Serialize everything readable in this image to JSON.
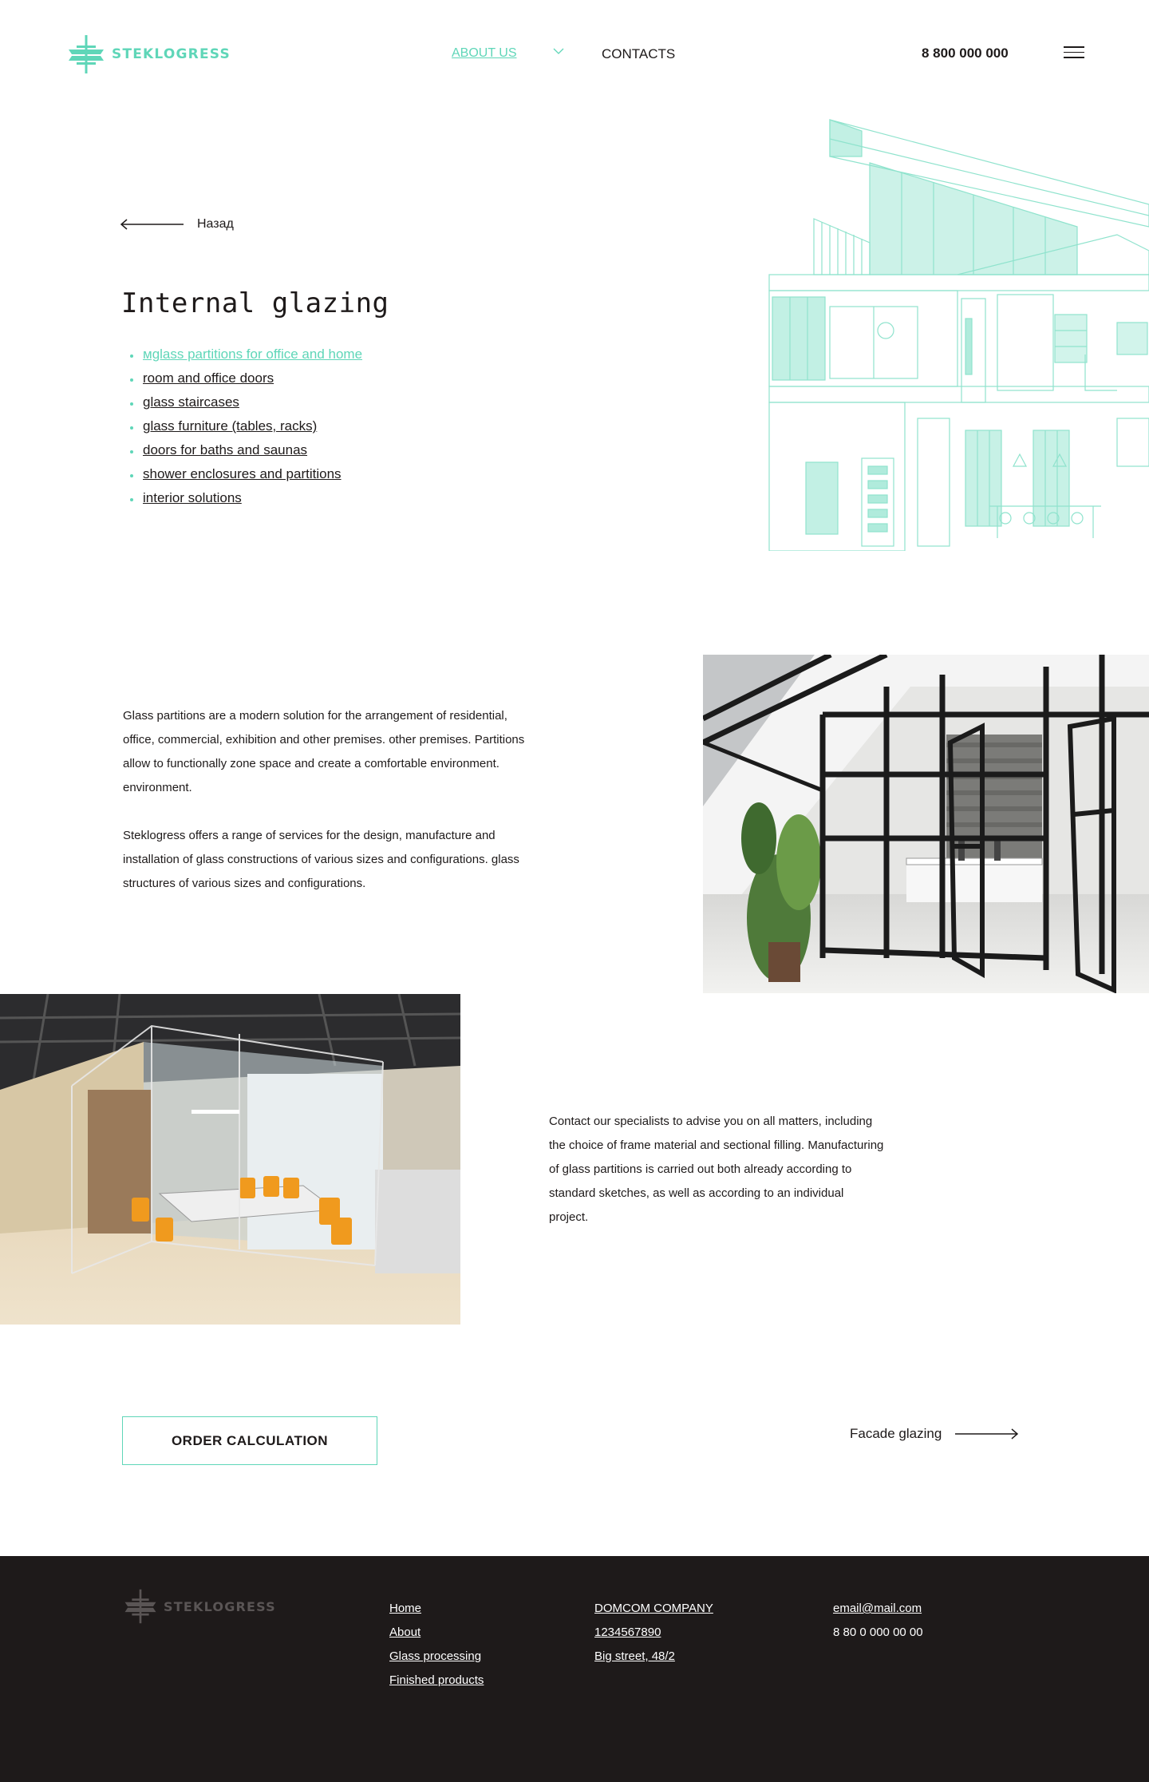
{
  "header": {
    "logo_text": "STEKLOGRESS",
    "nav_about": "ABOUT US",
    "nav_contacts": "CONTACTS",
    "phone": "8 800 000 000"
  },
  "hero": {
    "back_label": "Назад",
    "title": "Internal glazing",
    "items": [
      "мglass partitions for office and home",
      "room and office doors",
      "glass staircases",
      "glass furniture (tables, racks)",
      "doors for baths and saunas",
      "shower enclosures and partitions",
      "interior solutions"
    ]
  },
  "content": {
    "paragraph_1": "Glass partitions are a modern solution for the arrangement of residential, office, commercial, exhibition and other premises. other premises. Partitions allow to functionally zone space and create a comfortable environment. environment.",
    "paragraph_2": "Steklogress offers a range of services for the design, manufacture and installation of glass constructions of various sizes and configurations. glass structures of various sizes and configurations.",
    "paragraph_3": "Contact our specialists to advise you on all matters, including the choice of frame material and sectional filling. Manufacturing of glass partitions is carried out both already according to standard sketches, as well as according to an individual project."
  },
  "cta": {
    "order_label": "ORDER CALCULATION",
    "next_label": "Facade glazing"
  },
  "footer": {
    "logo_text": "STEKLOGRESS",
    "nav": [
      "Home",
      "About",
      "Glass processing",
      "Finished products"
    ],
    "company": [
      "DOMCOM COMPANY",
      "1234567890",
      "Big street, 48/2"
    ],
    "email": "email@mail.com",
    "phone": "8 80 0 000 00 00"
  },
  "colors": {
    "accent": "#5fd6b8",
    "text": "#1e1a1a",
    "footer_bg": "#1e1a1a"
  }
}
